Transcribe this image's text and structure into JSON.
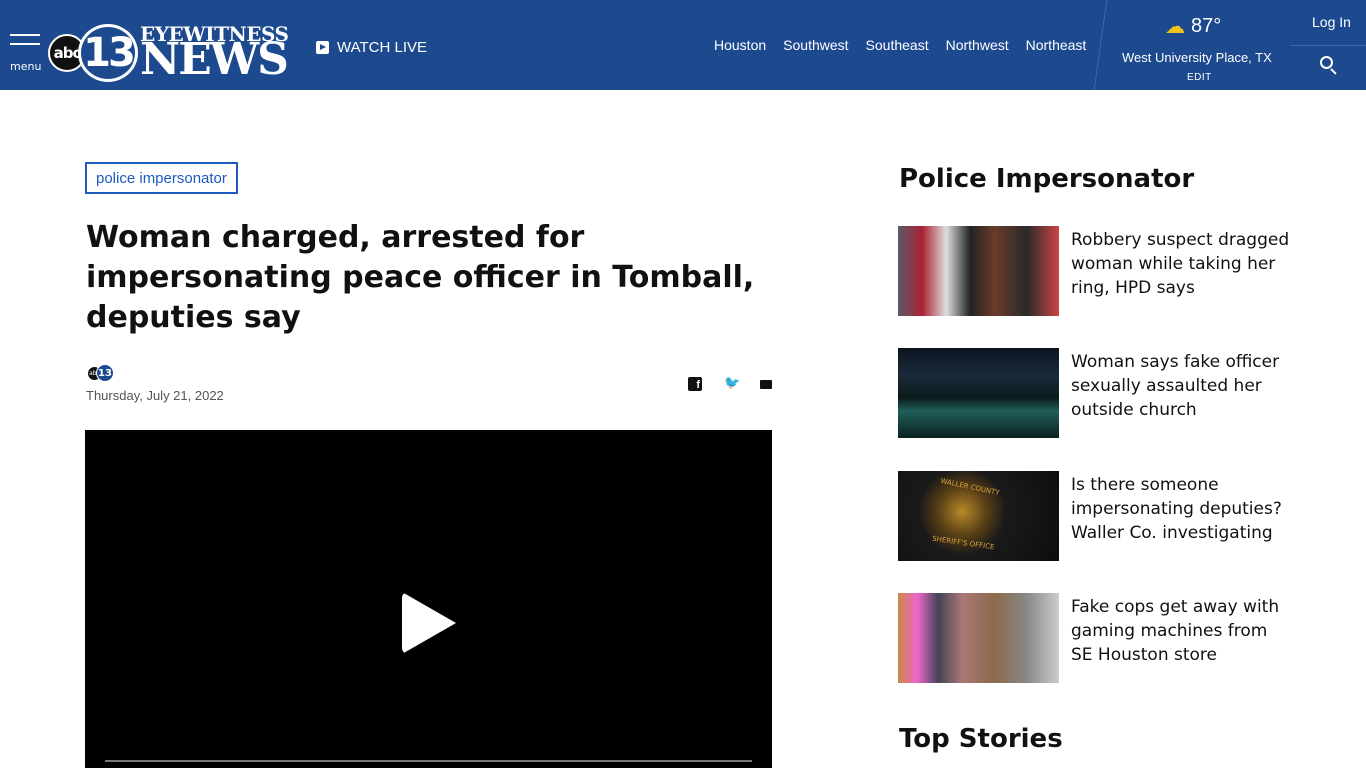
{
  "header": {
    "menu_label": "menu",
    "logo_abc": "abc",
    "logo_number": "13",
    "logo_eyewitness": "EYEWITNESS",
    "logo_news": "NEWS",
    "watch_live": "WATCH LIVE",
    "regions": [
      "Houston",
      "Southwest",
      "Southeast",
      "Northwest",
      "Northeast"
    ],
    "weather": {
      "icon": "partly-cloudy-icon",
      "temperature": "87°",
      "location": "West University Place, TX",
      "edit": "EDIT"
    },
    "login": "Log In",
    "colors": {
      "bar": "#1d4a8f",
      "accent": "#1d5bbf"
    }
  },
  "article": {
    "tag": "police impersonator",
    "headline": "Woman charged, arrested for impersonating peace officer in Tomball, deputies say",
    "byline_logo_abc": "abc",
    "byline_logo_number": "13",
    "date": "Thursday, July 21, 2022",
    "share_icons": [
      "facebook-icon",
      "twitter-icon",
      "email-icon"
    ]
  },
  "sidebar": {
    "title": "Police Impersonator",
    "stories": [
      {
        "headline": "Robbery suspect dragged woman while taking her ring, HPD says"
      },
      {
        "headline": "Woman says fake officer sexually assaulted her outside church"
      },
      {
        "headline": "Is there someone impersonating deputies? Waller Co. investigating",
        "thumb_caption_top": "WALLER COUNTY",
        "thumb_caption_bottom": "SHERIFF'S OFFICE"
      },
      {
        "headline": "Fake cops get away with gaming machines from SE Houston store"
      }
    ],
    "top_stories": "Top Stories"
  }
}
